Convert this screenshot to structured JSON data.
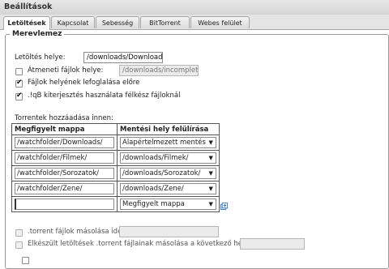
{
  "window": {
    "title": "Beállítások"
  },
  "tabs": [
    {
      "label": "Letöltések",
      "active": true
    },
    {
      "label": "Kapcsolat",
      "active": false
    },
    {
      "label": "Sebesség",
      "active": false
    },
    {
      "label": "BitTorrent",
      "active": false
    },
    {
      "label": "Webes felület",
      "active": false
    }
  ],
  "section": {
    "legend": "Merevlemez"
  },
  "save_path": {
    "label": "Letöltés helye:",
    "value": "/downloads/Downloads/"
  },
  "temp_path": {
    "label": "Átmeneti fájlok helye:",
    "value": "/downloads/incomplete/",
    "checked": false
  },
  "prealloc": {
    "label": "Fájlok helyének lefoglalása előre",
    "checked": true
  },
  "incomplete_ext": {
    "label": ".!qB kiterjesztés használata félkész fájloknál",
    "checked": true
  },
  "watch": {
    "caption": "Torrentek hozzáadása innen:",
    "col_folder": "Megfigyelt mappa",
    "col_save": "Mentési hely felülírása",
    "rows": [
      {
        "folder": "/watchfolder/Downloads/",
        "save": "Alapértelmezett mentés"
      },
      {
        "folder": "/watchfolder/Filmek/",
        "save": "/downloads/Filmek/"
      },
      {
        "folder": "/watchfolder/Sorozatok/",
        "save": "/downloads/Sorozatok/"
      },
      {
        "folder": "/watchfolder/Zene/",
        "save": "/downloads/Zene/"
      },
      {
        "folder": "",
        "save": "Megfigyelt mappa"
      }
    ],
    "arrow": "▼"
  },
  "copy_torrent": {
    "label": ".torrent fájlok másolása ide:",
    "checked": false,
    "value": ""
  },
  "copy_finished": {
    "label": "Elkészült letöltések .torrent fájlainak másolása a következő helyre:",
    "checked": false,
    "value": ""
  },
  "colors": {
    "accent_icon": "#3a7bbf"
  }
}
